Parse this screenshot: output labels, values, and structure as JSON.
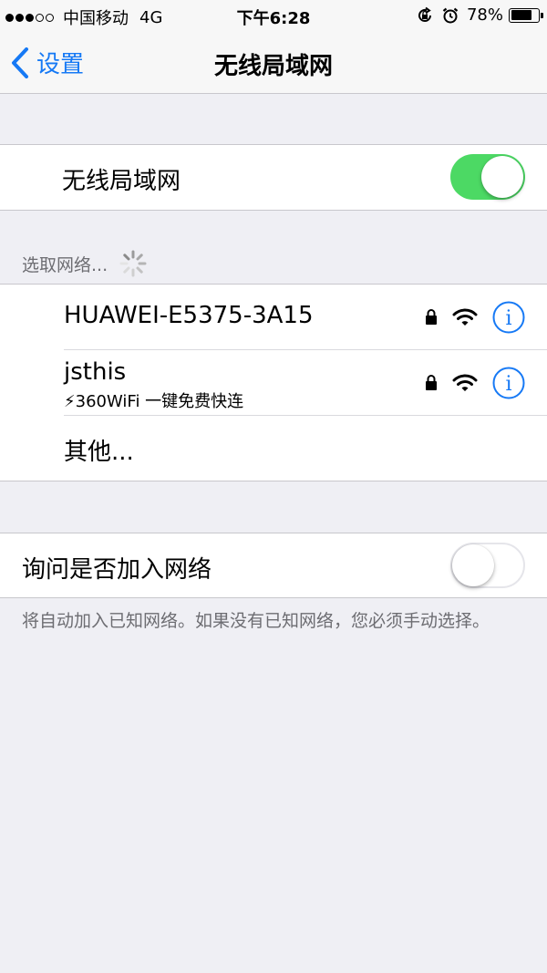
{
  "status_bar": {
    "carrier": "中国移动",
    "network": "4G",
    "time": "下午6:28",
    "battery_percent": "78%",
    "battery_level": 0.78,
    "signal_bars_filled": 3,
    "signal_bars_total": 5
  },
  "nav": {
    "back_label": "设置",
    "title": "无线局域网"
  },
  "wifi_toggle": {
    "label": "无线局域网",
    "state": "on"
  },
  "networks_section": {
    "header": "选取网络..."
  },
  "networks": [
    {
      "name": "HUAWEI-E5375-3A15",
      "secured": true
    },
    {
      "name": "jsthis",
      "subtitle": "⚡360WiFi 一键免费快连",
      "secured": true
    }
  ],
  "other_label": "其他...",
  "ask_to_join": {
    "label": "询问是否加入网络",
    "state": "off",
    "footer": "将自动加入已知网络。如果没有已知网络，您必须手动选择。"
  },
  "colors": {
    "accent": "#1679f5",
    "toggle_on": "#4cd964",
    "background": "#efeff4"
  }
}
